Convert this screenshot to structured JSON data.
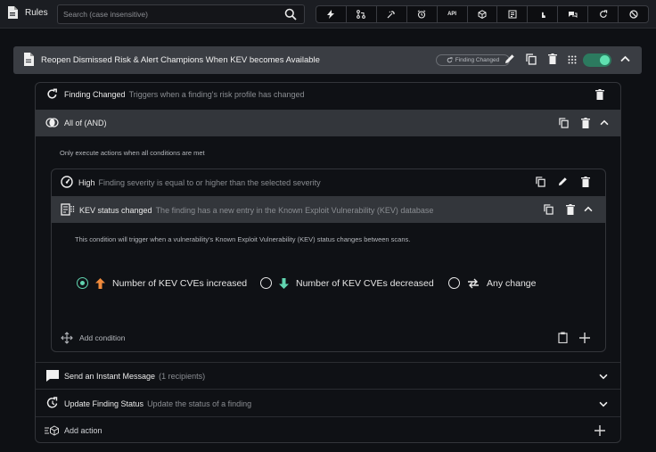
{
  "topbar": {
    "title": "Rules",
    "search_placeholder": "Search (case insensitive)",
    "tools": [
      "bolt-icon",
      "branch-icon",
      "sparkle-icon",
      "alarm-icon",
      "API",
      "cube-icon",
      "list-check-icon",
      "touch-icon",
      "chat-icon",
      "refresh-icon",
      "block-icon"
    ]
  },
  "rule": {
    "title": "Reopen Dismissed Risk & Alert Champions When KEV becomes Available",
    "trigger_chip": "Finding Changed",
    "enabled": true
  },
  "trigger": {
    "label": "Finding Changed",
    "description": "Triggers when a finding's risk profile has changed"
  },
  "group": {
    "label": "All of (AND)",
    "note": "Only execute actions when all conditions are met"
  },
  "conditions": [
    {
      "label": "High",
      "description": "Finding severity is equal to or higher than the selected severity"
    },
    {
      "label": "KEV status changed",
      "description": "The finding has a new entry in the Known Exploit Vulnerability (KEV) database",
      "note": "This condition will trigger when a vulnerability's Known Exploit Vulnerability (KEV) status changes between scans.",
      "options": [
        {
          "label": "Number of KEV CVEs increased",
          "selected": true,
          "icon": "arrow-up-icon",
          "color": "#f08a3c"
        },
        {
          "label": "Number of KEV CVEs decreased",
          "selected": false,
          "icon": "arrow-down-icon",
          "color": "#61d4b0"
        },
        {
          "label": "Any change",
          "selected": false,
          "icon": "swap-icon",
          "color": "#e8e8e8"
        }
      ]
    }
  ],
  "add_condition_label": "Add condition",
  "actions": [
    {
      "label": "Send an Instant Message",
      "description": "(1 recipients)"
    },
    {
      "label": "Update Finding Status",
      "description": "Update the status of a finding"
    }
  ],
  "add_action_label": "Add action",
  "colors": {
    "accent": "#61d4b0",
    "toggle_track": "#2c7a5f",
    "arrow_up": "#f08a3c"
  }
}
